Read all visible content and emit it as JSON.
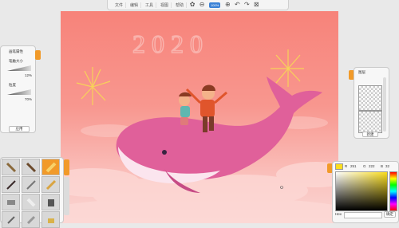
{
  "menubar": {
    "items": [
      "文件",
      "编辑",
      "工具",
      "视图",
      "帮助"
    ],
    "zoom_label": "100%"
  },
  "brush_panel": {
    "title": "画笔属性",
    "size_label": "笔触大小",
    "size_value": "12%",
    "opacity_label": "粒度",
    "opacity_value": "70%",
    "apply_label": "应用"
  },
  "layers_panel": {
    "title": "图层",
    "new_label": "新建"
  },
  "color_panel": {
    "r_label": "R",
    "r_value": "251",
    "g_label": "G",
    "g_value": "222",
    "b_label": "B",
    "b_value": "32",
    "hex_label": "Hex",
    "ok_label": "确定",
    "swatch_color": "#fbde20"
  },
  "canvas": {
    "bg_top": "#f7837a",
    "bg_bottom": "#fbd7d4",
    "whale_color": "#e0609a",
    "year_text": "2020"
  },
  "accent_color": "#f19a2a"
}
